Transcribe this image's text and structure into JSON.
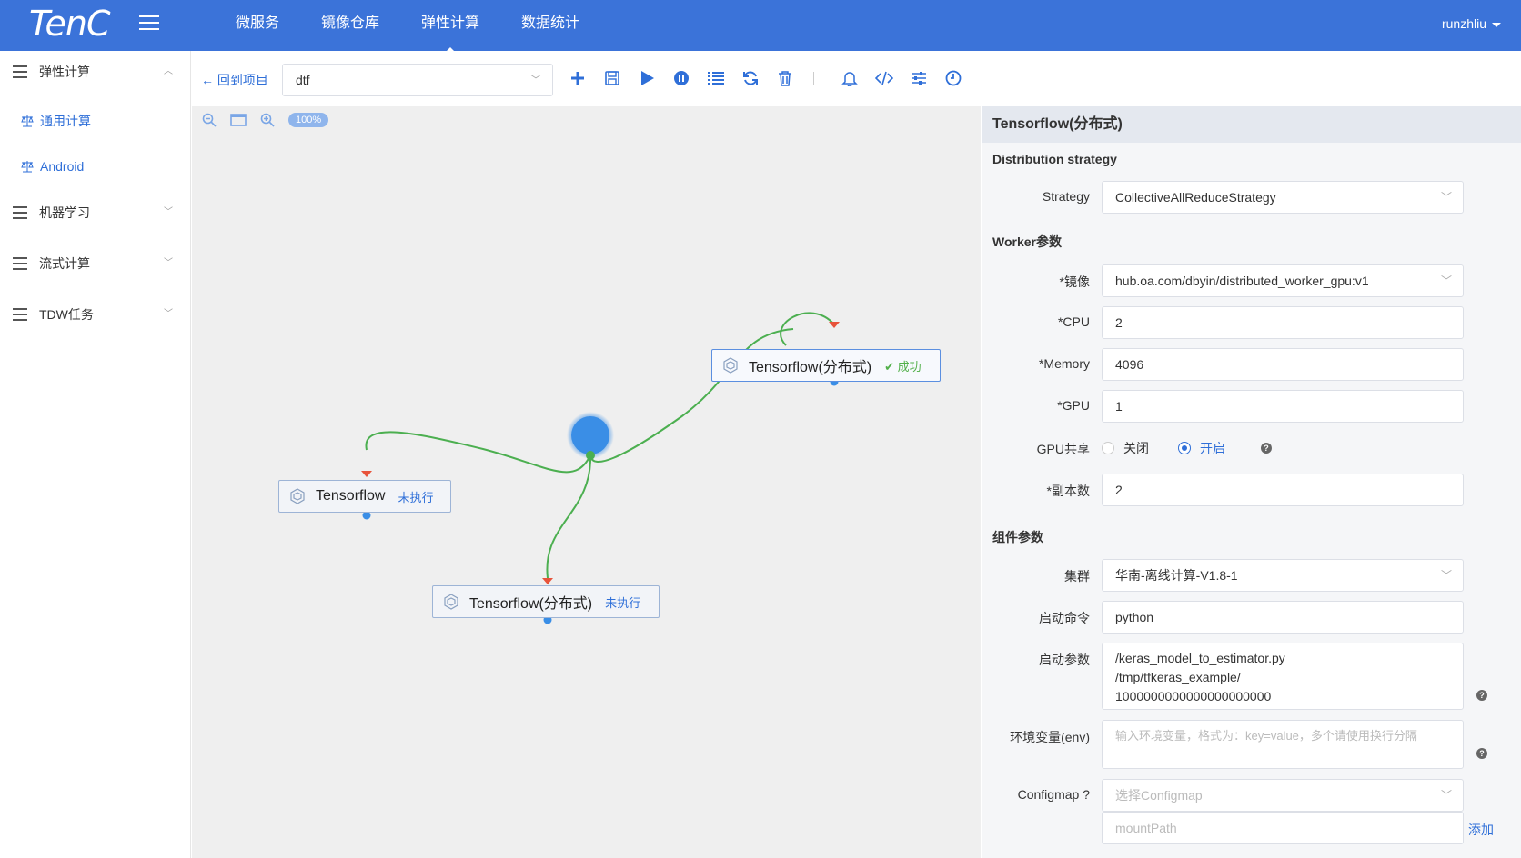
{
  "app": {
    "logo": "TenC",
    "user": "runzhliu"
  },
  "topnav": [
    {
      "label": "微服务"
    },
    {
      "label": "镜像仓库"
    },
    {
      "label": "弹性计算"
    },
    {
      "label": "数据统计"
    }
  ],
  "sidebar": {
    "groups": [
      {
        "label": "弹性计算",
        "expanded": true,
        "children": [
          {
            "label": "通用计算"
          },
          {
            "label": "Android"
          }
        ]
      },
      {
        "label": "机器学习"
      },
      {
        "label": "流式计算"
      },
      {
        "label": "TDW任务"
      }
    ]
  },
  "toolbar": {
    "back_label": "回到项目",
    "project": "dtf",
    "icons": [
      "plus-icon",
      "save-icon",
      "play-icon",
      "pause-icon",
      "list-icon",
      "refresh-icon",
      "trash-icon",
      "bell-icon",
      "code-icon",
      "sliders-icon",
      "clock-icon"
    ]
  },
  "canvas": {
    "zoom": "100%",
    "nodes": [
      {
        "title": "Tensorflow(分布式)",
        "status": "成功",
        "status_type": "success"
      },
      {
        "title": "Tensorflow",
        "status": "未执行",
        "status_type": "pending"
      },
      {
        "title": "Tensorflow(分布式)",
        "status": "未执行",
        "status_type": "pending"
      }
    ]
  },
  "panel": {
    "title": "Tensorflow(分布式)",
    "sections": {
      "distribution": "Distribution strategy",
      "worker": "Worker参数",
      "component": "组件参数"
    },
    "strategy": {
      "label": "Strategy",
      "value": "CollectiveAllReduceStrategy"
    },
    "image": {
      "label": "*镜像",
      "value": "hub.oa.com/dbyin/distributed_worker_gpu:v1"
    },
    "cpu": {
      "label": "*CPU",
      "value": "2"
    },
    "memory": {
      "label": "*Memory",
      "value": "4096"
    },
    "gpu": {
      "label": "*GPU",
      "value": "1"
    },
    "gpu_share": {
      "label": "GPU共享",
      "off": "关闭",
      "on": "开启",
      "selected": "on"
    },
    "replicas": {
      "label": "*副本数",
      "value": "2"
    },
    "cluster": {
      "label": "集群",
      "value": "华南-离线计算-V1.8-1"
    },
    "command": {
      "label": "启动命令",
      "value": "python"
    },
    "args": {
      "label": "启动参数",
      "value": "/keras_model_to_estimator.py\n/tmp/tfkeras_example/\n1000000000000000000000"
    },
    "env": {
      "label": "环境变量(env)",
      "placeholder": "输入环境变量，格式为：key=value，多个请使用换行分隔"
    },
    "configmap": {
      "label": "Configmap ?",
      "placeholder": "选择Configmap",
      "mount_placeholder": "mountPath",
      "add_label": "添加"
    }
  },
  "colors": {
    "primary": "#3b73d9",
    "link": "#2f6fd8",
    "success": "#52b04a",
    "edge": "#4caf50",
    "anchor_in": "#e8533a",
    "anchor_out": "#3a8ee6"
  }
}
